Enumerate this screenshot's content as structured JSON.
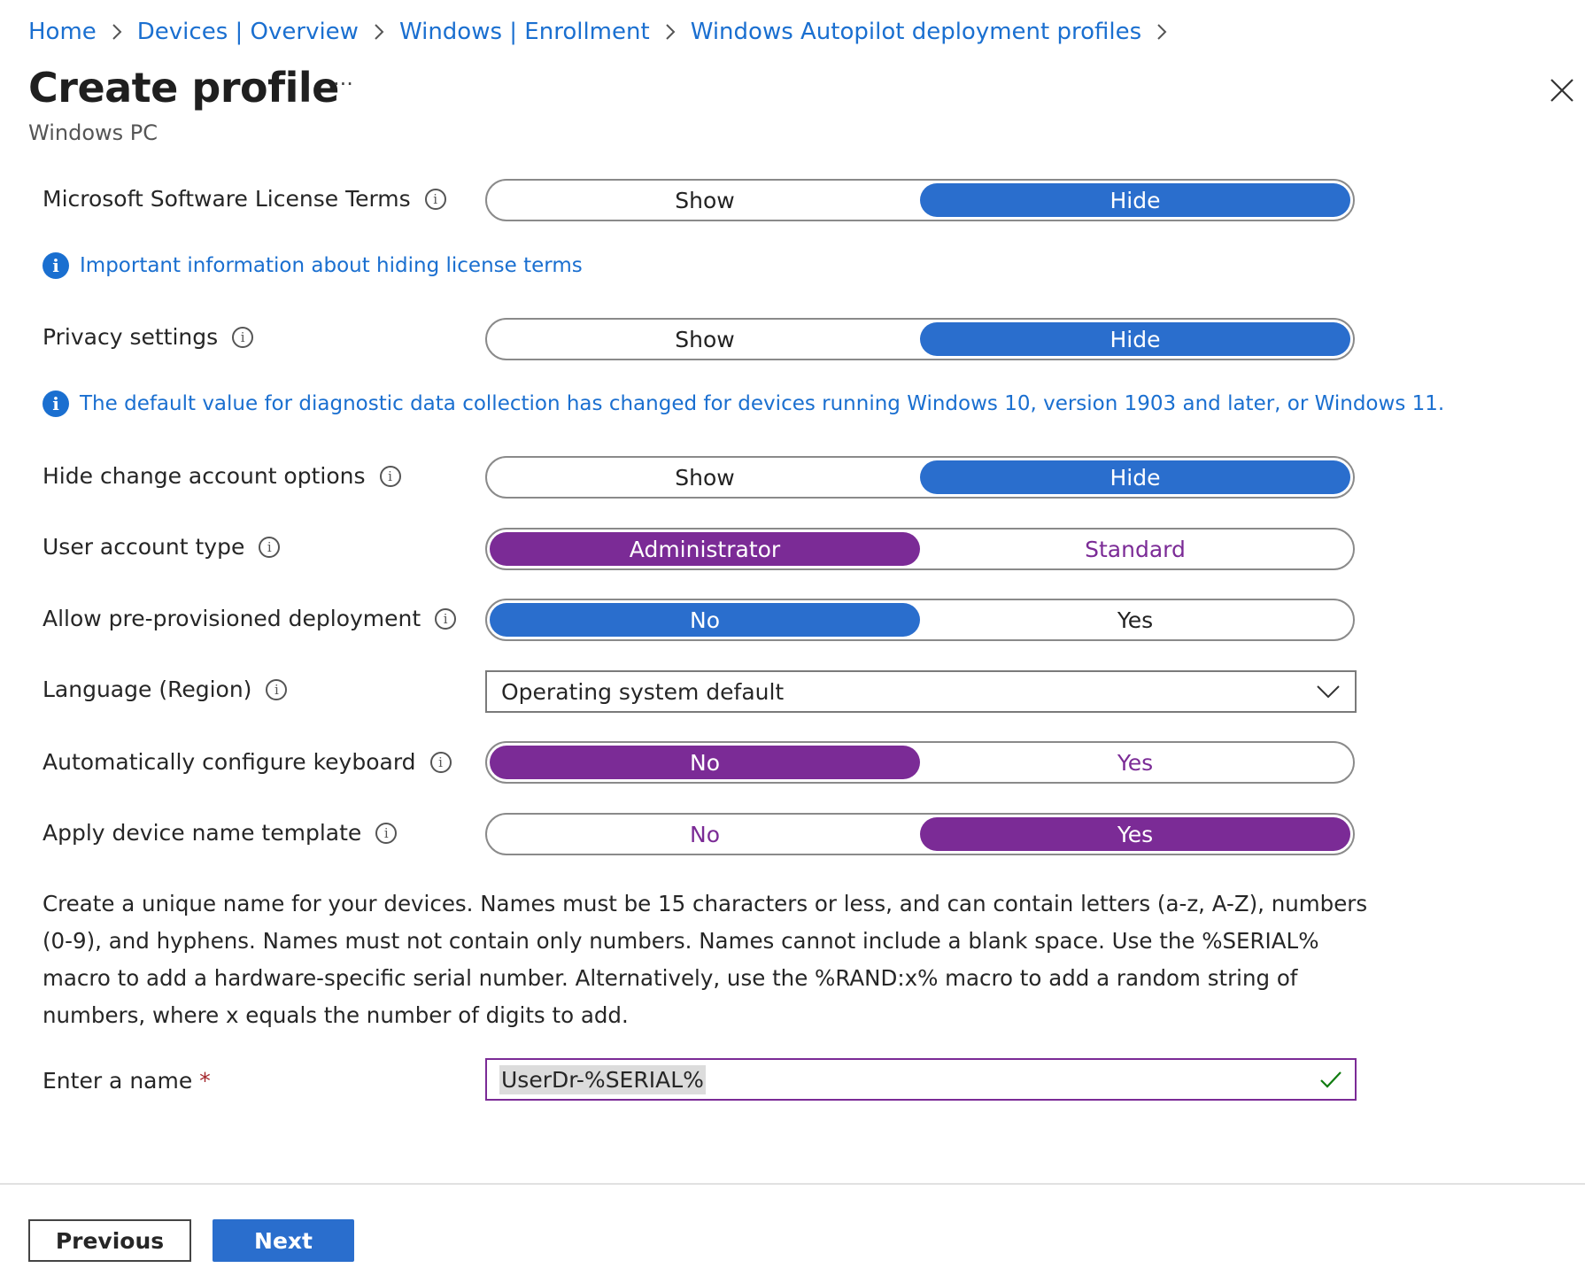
{
  "breadcrumb": [
    "Home",
    "Devices | Overview",
    "Windows | Enrollment",
    "Windows Autopilot deployment profiles"
  ],
  "header": {
    "title": "Create profile",
    "more_label": "···",
    "subtitle": "Windows PC"
  },
  "settings": {
    "license_terms": {
      "label": "Microsoft Software License Terms",
      "options": [
        "Show",
        "Hide"
      ],
      "selected": "Hide"
    },
    "license_notice": "Important information about hiding license terms",
    "privacy": {
      "label": "Privacy settings",
      "options": [
        "Show",
        "Hide"
      ],
      "selected": "Hide"
    },
    "privacy_notice": "The default value for diagnostic data collection has changed for devices running Windows 10, version 1903 and later, or Windows 11.",
    "change_account": {
      "label": "Hide change account options",
      "options": [
        "Show",
        "Hide"
      ],
      "selected": "Hide"
    },
    "account_type": {
      "label": "User account type",
      "options": [
        "Administrator",
        "Standard"
      ],
      "selected": "Administrator"
    },
    "pre_provisioned": {
      "label": "Allow pre-provisioned deployment",
      "options": [
        "No",
        "Yes"
      ],
      "selected": "No"
    },
    "language": {
      "label": "Language (Region)",
      "value": "Operating system default"
    },
    "keyboard": {
      "label": "Automatically configure keyboard",
      "options": [
        "No",
        "Yes"
      ],
      "selected": "No"
    },
    "name_template": {
      "label": "Apply device name template",
      "options": [
        "No",
        "Yes"
      ],
      "selected": "Yes"
    },
    "name_description": "Create a unique name for your devices. Names must be 15 characters or less, and can contain letters (a-z, A-Z), numbers (0-9), and hyphens. Names must not contain only numbers. Names cannot include a blank space. Use the %SERIAL% macro to add a hardware-specific serial number. Alternatively, use the %RAND:x% macro to add a random string of numbers, where x equals the number of digits to add.",
    "enter_name": {
      "label": "Enter a name",
      "required_mark": "*",
      "value": "UserDr-%SERIAL%"
    }
  },
  "footer": {
    "previous_label": "Previous",
    "next_label": "Next"
  },
  "colors": {
    "accent_blue": "#2a6ecd",
    "accent_purple": "#7b2b96",
    "link": "#1a6fd0",
    "valid_check": "#107c10"
  }
}
